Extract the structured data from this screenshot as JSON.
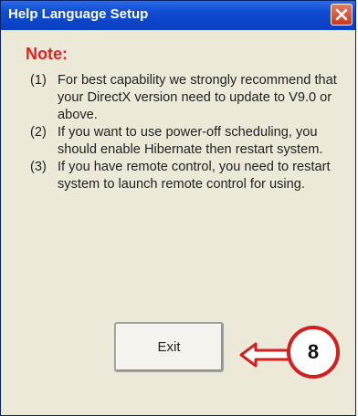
{
  "window": {
    "title": "Help Language Setup",
    "close_icon": "close-icon"
  },
  "note": {
    "heading": "Note:",
    "items": [
      {
        "num": "(1)",
        "text": "For best capability we strongly recommend that your DirectX version need to update to V9.0 or above."
      },
      {
        "num": "(2)",
        "text": "If you want to use power-off scheduling, you should enable Hibernate then restart system."
      },
      {
        "num": "(3)",
        "text": "If you have remote control, you need to restart system to launch remote control for using."
      }
    ]
  },
  "buttons": {
    "exit_label": "Exit"
  },
  "annotation": {
    "callout_number": "8",
    "arrow_icon": "left-arrow-icon",
    "color": "#d21f1f"
  },
  "colors": {
    "titlebar": "#0f4bd0",
    "window_bg": "#ece9d8",
    "note_heading": "#e32020"
  }
}
